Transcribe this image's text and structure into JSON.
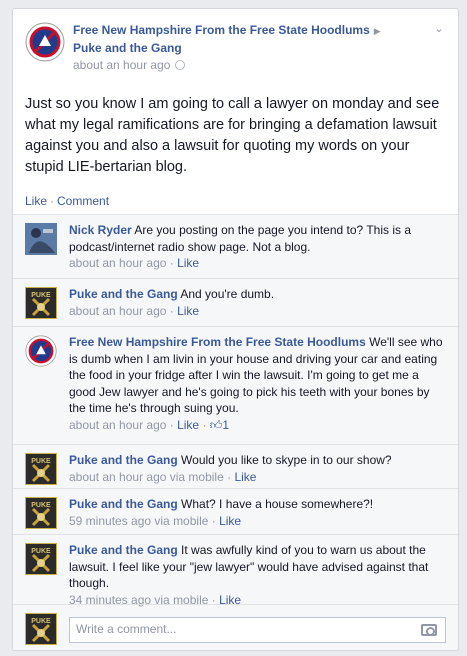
{
  "post": {
    "author": "Free New Hampshire From the Free State Hoodlums",
    "target": "Puke and the Gang",
    "timestamp": "about an hour ago",
    "text": "Just so you know I am going to call a lawyer on monday and see what my legal ramifications are for bringing a defamation lawsuit against you and also a lawsuit for quoting my words on your stupid LIE-bertarian blog."
  },
  "actions": {
    "like": "Like",
    "comment": "Comment"
  },
  "comments": [
    {
      "author": "Nick Ryder",
      "text": "Are you posting on the page you intend to? This is a podcast/internet radio show page. Not a blog.",
      "time": "about an hour ago",
      "like": "Like"
    },
    {
      "author": "Puke and the Gang",
      "text": "And you're dumb.",
      "time": "about an hour ago",
      "like": "Like"
    },
    {
      "author": "Free New Hampshire From the Free State Hoodlums",
      "text": "We'll see who is dumb when I am livin in your house and driving your car and eating the food in your fridge after I win the lawsuit. I'm going to get me a good Jew lawyer and he's going to pick his teeth with your bones by the time he's through suing you.",
      "time": "about an hour ago",
      "like": "Like",
      "likes": "1"
    },
    {
      "author": "Puke and the Gang",
      "text": "Would you like to skype in to our show?",
      "time": "about an hour ago via mobile",
      "like": "Like"
    },
    {
      "author": "Puke and the Gang",
      "text": "What? I have a house somewhere?!",
      "time": "59 minutes ago via mobile",
      "like": "Like"
    },
    {
      "author": "Puke and the Gang",
      "text": "It was awfully kind of you to warn us about the lawsuit. I feel like your \"jew lawyer\" would have advised against that though.",
      "time": "34 minutes ago via mobile",
      "like": "Like"
    }
  ],
  "composer": {
    "placeholder": "Write a comment..."
  },
  "colors": {
    "link": "#3b5998",
    "meta": "#9197a3",
    "comment_bg": "#f6f7f9"
  }
}
